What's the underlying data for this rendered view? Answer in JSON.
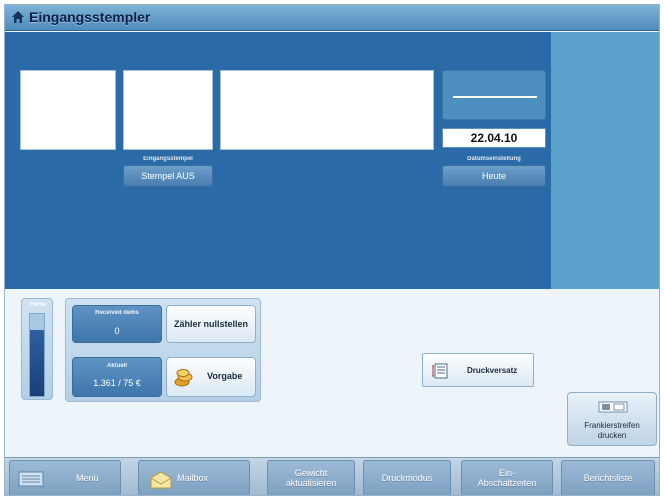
{
  "window": {
    "title": "Eingangsstempler"
  },
  "stamp": {
    "caption": "Eingangsstempel",
    "button_label": "Stempel AUS"
  },
  "date_setting": {
    "caption": "Datumseinstellung",
    "button_label": "Heute",
    "date_value": "22.04.10"
  },
  "ink": {
    "label": "Farbe",
    "level": 0.8
  },
  "received_items": {
    "label": "Received items",
    "value": "0"
  },
  "reset_button": {
    "label": "Zähler nullstellen"
  },
  "current": {
    "label": "Aktuell",
    "value": "1.361 / 75 €"
  },
  "preset_button": {
    "label": "Vorgabe"
  },
  "print_offset_button": {
    "label": "Druckversatz"
  },
  "print_strip_button": {
    "label_line1": "Frankierstreifen",
    "label_line2": "drucken"
  },
  "nav": {
    "menu": "Menü",
    "mailbox": "Mailbox",
    "update_weight_line1": "Gewicht",
    "update_weight_line2": "aktualisieren",
    "print_mode": "Druckmodus",
    "on_off_line1": "Ein-",
    "on_off_line2": "Abschaltzeiten",
    "report_list": "Berichtsliste"
  },
  "colors": {
    "stage_blue": "#2a6aa6",
    "side_blue": "#5aa2cc",
    "title_text": "#0b1f46"
  },
  "icons": [
    "home-icon",
    "menu-list-icon",
    "mailbox-icon",
    "coins-icon",
    "print-offset-icon",
    "print-strip-icon"
  ]
}
